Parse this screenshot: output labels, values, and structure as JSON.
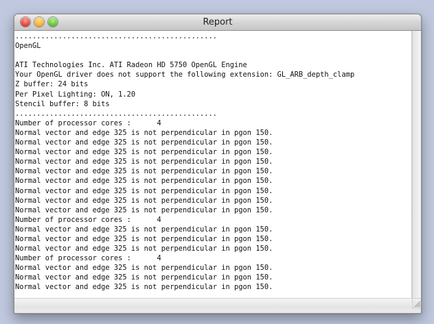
{
  "window": {
    "title": "Report"
  },
  "traffic_lights": {
    "close_icon": "close-icon",
    "minimize_icon": "minimize-icon",
    "zoom_icon": "zoom-icon"
  },
  "report": {
    "lines": [
      "...............................................",
      "OpenGL",
      "",
      "ATI Technologies Inc. ATI Radeon HD 5750 OpenGL Engine",
      "Your OpenGL driver does not support the following extension: GL_ARB_depth_clamp",
      "Z buffer: 24 bits",
      "Per Pixel Lighting: ON, 1.20",
      "Stencil buffer: 8 bits",
      "...............................................",
      "Number of processor cores :      4",
      "Normal vector and edge 325 is not perpendicular in pgon 150.",
      "Normal vector and edge 325 is not perpendicular in pgon 150.",
      "Normal vector and edge 325 is not perpendicular in pgon 150.",
      "Normal vector and edge 325 is not perpendicular in pgon 150.",
      "Normal vector and edge 325 is not perpendicular in pgon 150.",
      "Normal vector and edge 325 is not perpendicular in pgon 150.",
      "Normal vector and edge 325 is not perpendicular in pgon 150.",
      "Normal vector and edge 325 is not perpendicular in pgon 150.",
      "Normal vector and edge 325 is not perpendicular in pgon 150.",
      "Number of processor cores :      4",
      "Normal vector and edge 325 is not perpendicular in pgon 150.",
      "Normal vector and edge 325 is not perpendicular in pgon 150.",
      "Normal vector and edge 325 is not perpendicular in pgon 150.",
      "Number of processor cores :      4",
      "Normal vector and edge 325 is not perpendicular in pgon 150.",
      "Normal vector and edge 325 is not perpendicular in pgon 150.",
      "Normal vector and edge 325 is not perpendicular in pgon 150."
    ]
  }
}
